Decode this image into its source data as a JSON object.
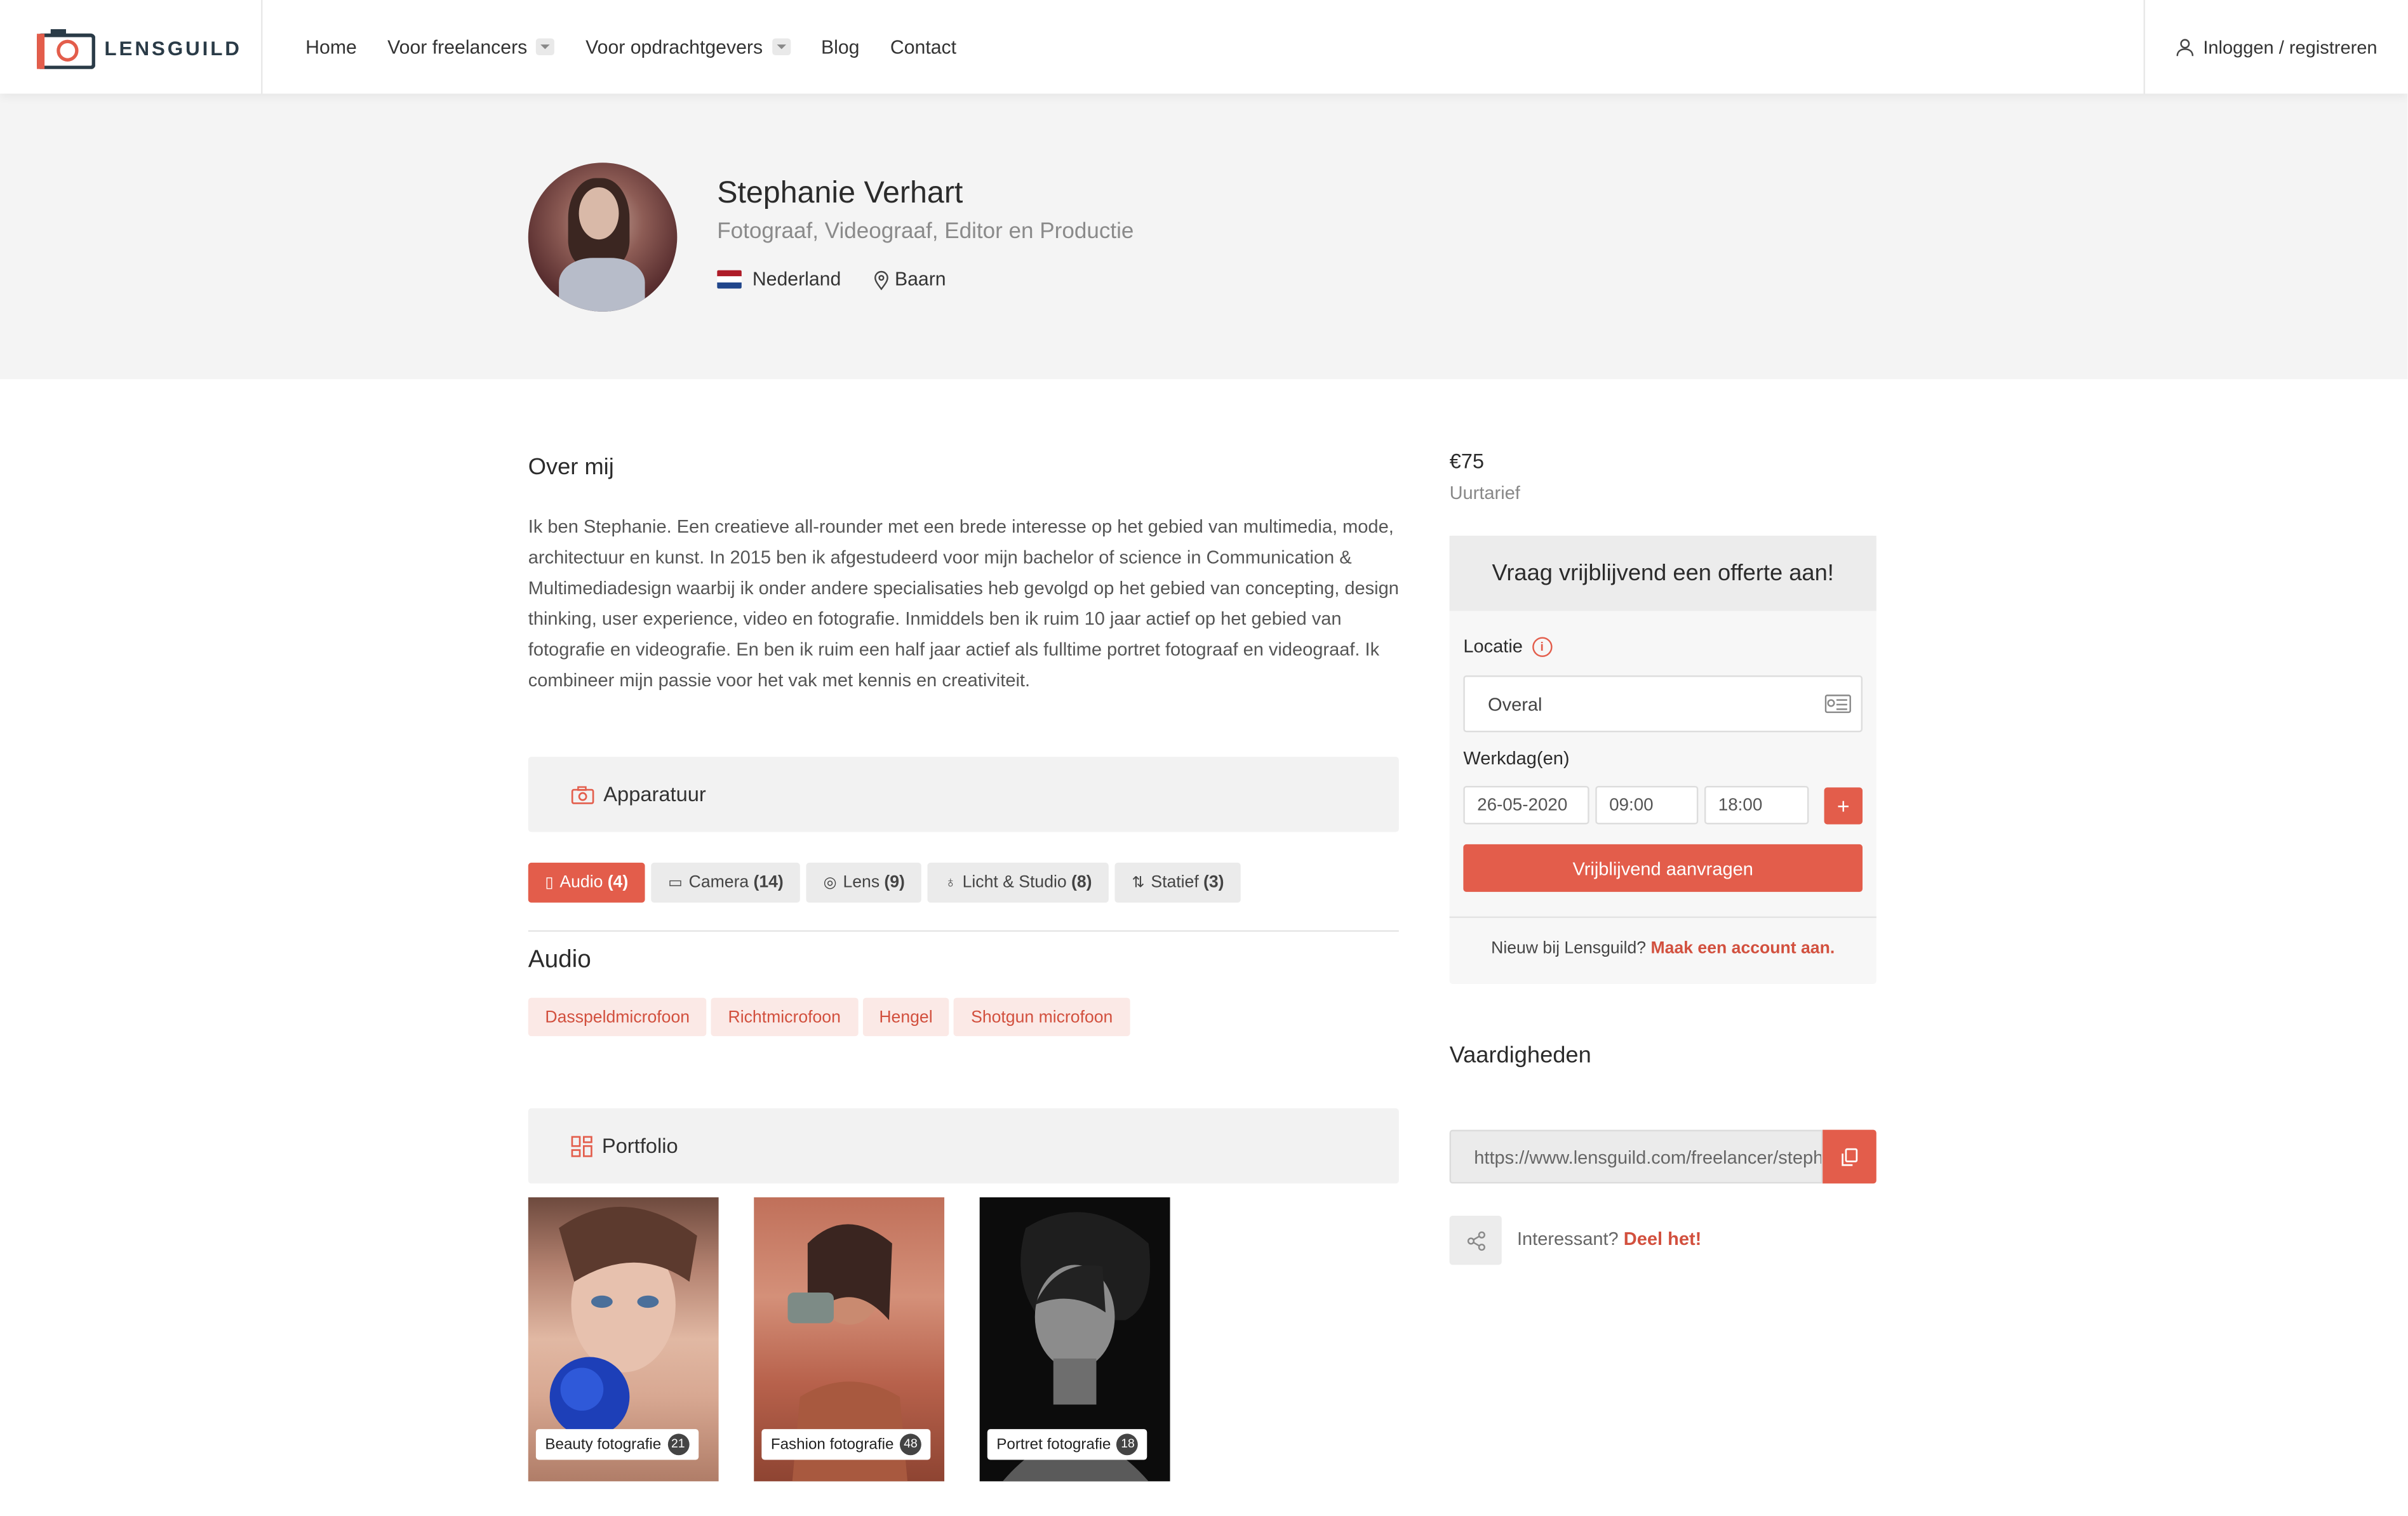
{
  "brand": {
    "name": "LENSGUILD"
  },
  "nav": {
    "items": [
      {
        "label": "Home",
        "dropdown": false
      },
      {
        "label": "Voor freelancers",
        "dropdown": true
      },
      {
        "label": "Voor opdrachtgevers",
        "dropdown": true
      },
      {
        "label": "Blog",
        "dropdown": false
      },
      {
        "label": "Contact",
        "dropdown": false
      }
    ],
    "login_label": "Inloggen / registreren"
  },
  "profile": {
    "name": "Stephanie Verhart",
    "roles": "Fotograaf, Videograaf, Editor en Productie",
    "country": "Nederland",
    "city": "Baarn"
  },
  "about": {
    "title": "Over mij",
    "text": "Ik ben Stephanie. Een creatieve all-rounder met een brede interesse op het gebied van multimedia, mode, architectuur en kunst. In 2015 ben ik afgestudeerd voor mijn bachelor of science in Communication & Multimediadesign waarbij ik onder andere specialisaties heb gevolgd op het gebied van concepting, design thinking, user experience, video en fotografie. Inmiddels ben ik ruim 10 jaar actief op het gebied van fotografie en videografie. En ben ik ruim een half jaar actief als fulltime portret fotograaf en videograaf. Ik combineer mijn passie voor het vak met kennis en creativiteit."
  },
  "equipment": {
    "title": "Apparatuur",
    "tabs": [
      {
        "label": "Audio",
        "count": "(4)",
        "icon": "mic-icon",
        "active": true
      },
      {
        "label": "Camera",
        "count": "(14)",
        "icon": "camera-icon",
        "active": false
      },
      {
        "label": "Lens",
        "count": "(9)",
        "icon": "lens-icon",
        "active": false
      },
      {
        "label": "Licht & Studio",
        "count": "(8)",
        "icon": "bulb-icon",
        "active": false
      },
      {
        "label": "Statief",
        "count": "(3)",
        "icon": "tripod-icon",
        "active": false
      }
    ],
    "active_heading": "Audio",
    "items": [
      "Dasspeldmicrofoon",
      "Richtmicrofoon",
      "Hengel",
      "Shotgun microfoon"
    ]
  },
  "portfolio": {
    "title": "Portfolio",
    "albums": [
      {
        "label": "Beauty fotografie",
        "count": "21"
      },
      {
        "label": "Fashion fotografie",
        "count": "48"
      },
      {
        "label": "Portret fotografie",
        "count": "18"
      }
    ]
  },
  "pricing": {
    "rate": "€75",
    "rate_label": "Uurtarief"
  },
  "quote": {
    "title": "Vraag vrijblijvend een offerte aan!",
    "location_label": "Locatie",
    "location_value": "Overal",
    "workdays_label": "Werkdag(en)",
    "date": "26-05-2020",
    "start": "09:00",
    "end": "18:00",
    "add_label": "+",
    "submit_label": "Vrijblijvend aanvragen",
    "footer_text": "Nieuw bij Lensguild?",
    "footer_link": "Maak een account aan."
  },
  "skills": {
    "title": "Vaardigheden"
  },
  "share": {
    "url": "https://www.lensguild.com/freelancer/stephanie-verhart",
    "prompt": "Interessant?",
    "link": "Deel het!"
  },
  "colors": {
    "accent": "#e35d4b",
    "chip_bg": "#fbe9e6",
    "hero_bg": "#f4f4f4"
  }
}
